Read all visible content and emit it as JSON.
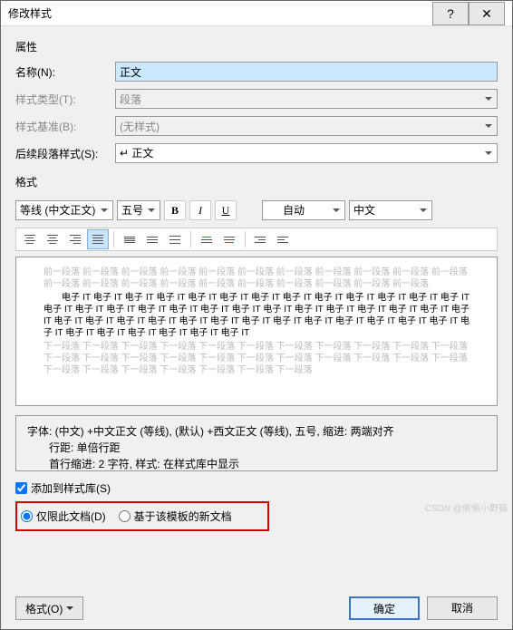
{
  "title": "修改样式",
  "sections": {
    "props": "属性",
    "format": "格式"
  },
  "props": {
    "name_label": "名称(N):",
    "name_value": "正文",
    "type_label": "样式类型(T):",
    "type_value": "段落",
    "base_label": "样式基准(B):",
    "base_value": "(无样式)",
    "next_label": "后续段落样式(S):",
    "next_value": "↵ 正文"
  },
  "toolbar": {
    "font": "等线 (中文正文)",
    "size": "五号",
    "color_label": "自动",
    "lang": "中文"
  },
  "preview": {
    "gray_top": "前一段落 前一段落 前一段落 前一段落 前一段落 前一段落 前一段落 前一段落 前一段落 前一段落 前一段落 前一段落 前一段落 前一段落 前一段落 前一段落 前一段落 前一段落 前一段落 前一段落 前一段落",
    "sample": "电子 IT 电子 IT 电子 IT 电子 IT 电子 IT 电子 IT 电子 IT 电子 IT 电子 IT 电子 IT 电子 IT 电子 IT 电子 IT 电子 IT 电子 IT 电子 IT 电子 IT 电子 IT 电子 IT 电子 IT 电子 IT 电子 IT 电子 IT 电子 IT 电子 IT 电子 IT 电子 IT 电子 IT 电子 IT 电子 IT 电子 IT 电子 IT 电子 IT 电子 IT 电子 IT 电子 IT 电子 IT 电子 IT 电子 IT 电子 IT 电子 IT 电子 IT 电子 IT 电子 IT 电子 IT 电子 IT 电子 IT",
    "gray_bottom": "下一段落 下一段落 下一段落 下一段落 下一段落 下一段落 下一段落 下一段落 下一段落 下一段落 下一段落 下一段落 下一段落 下一段落 下一段落 下一段落 下一段落 下一段落 下一段落 下一段落 下一段落 下一段落 下一段落 下一段落 下一段落 下一段落 下一段落 下一段落 下一段落"
  },
  "description": {
    "line1": "字体: (中文) +中文正文 (等线), (默认) +西文正文 (等线), 五号, 缩进: 两端对齐",
    "line2": "行距: 单倍行距",
    "line3": "首行缩进:  2 字符, 样式: 在样式库中显示"
  },
  "options": {
    "add_label": "添加到样式库(S)",
    "radio1": "仅限此文档(D)",
    "radio2": "基于该模板的新文档"
  },
  "footer": {
    "format_btn": "格式(O)",
    "ok": "确定",
    "cancel": "取消"
  },
  "watermark": "CSDN @偷偷小野猫"
}
